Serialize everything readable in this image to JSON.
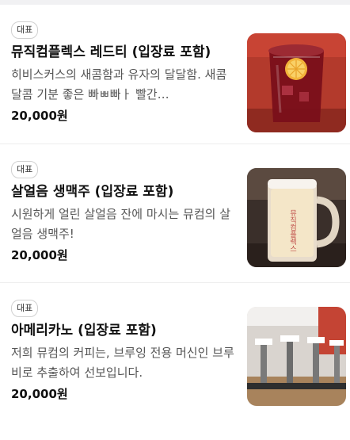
{
  "menu": {
    "items": [
      {
        "badge": "대표",
        "name": "뮤직컴플렉스 레드티 (입장료 포함)",
        "description": "히비스커스의 새콤함과 유자의 달달함. 새콤달콤 기분 좋은 빠ㅃ빠ㅏ 빨간…",
        "price": "20,000원",
        "image_icon": "red-iced-tea-photo"
      },
      {
        "badge": "대표",
        "name": "살얼음 생맥주 (입장료 포함)",
        "description": "시원하게 얼린 살얼음 잔에 마시는 뮤컴의 살얼음 생맥주!",
        "price": "20,000원",
        "image_icon": "frosted-beer-mug-photo",
        "mug_text": "뮤직컴플렉스"
      },
      {
        "badge": "대표",
        "name": "아메리카노 (입장료 포함)",
        "description": "저희 뮤컴의 커피는, 브루잉 전용 머신인 브루비로 추출하여 선보입니다.",
        "price": "20,000원",
        "image_icon": "brewing-machine-photo"
      }
    ]
  }
}
